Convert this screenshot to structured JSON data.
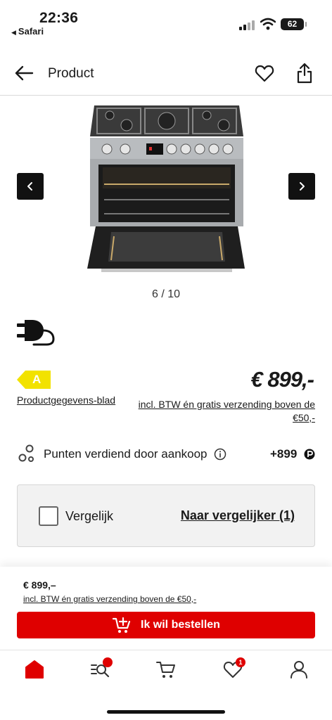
{
  "status_bar": {
    "time": "22:36",
    "back_app": "Safari",
    "battery": "62"
  },
  "header": {
    "title": "Product"
  },
  "gallery": {
    "counter": "6 / 10"
  },
  "product": {
    "energy_class": "A",
    "energy_color": "#f2e200",
    "datasheet_link": "Productgegevens-blad",
    "price": "€ 899,-",
    "price_note": "incl. BTW én gratis verzending boven de €50,-"
  },
  "points": {
    "label": "Punten verdiend door aankoop",
    "value": "+899"
  },
  "compare": {
    "checkbox_label": "Vergelijk",
    "link_label": "Naar vergelijker (1)"
  },
  "sticky": {
    "price": "€ 899,–",
    "note": "incl. BTW én gratis verzending boven de €50,-",
    "order_label": "Ik wil bestellen"
  },
  "tab_bar": {
    "search_badge": "",
    "wishlist_badge": "1"
  },
  "colors": {
    "brand_red": "#df0000"
  }
}
